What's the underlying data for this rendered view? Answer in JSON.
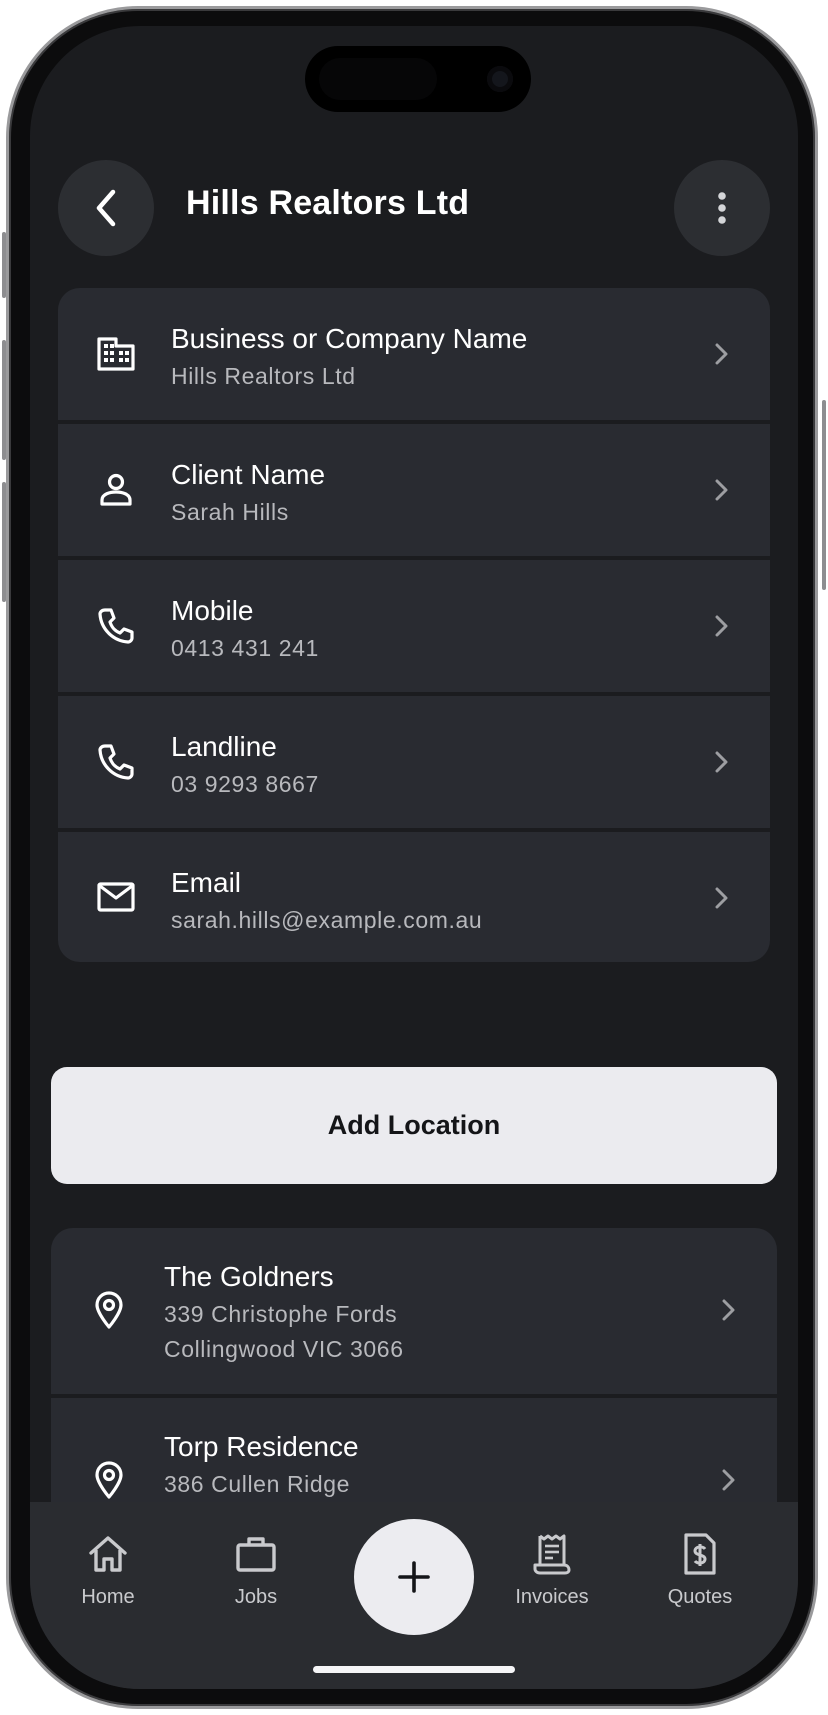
{
  "header": {
    "title": "Hills Realtors Ltd"
  },
  "contact_rows": [
    {
      "icon": "building-icon",
      "label": "Business or Company Name",
      "value": "Hills Realtors Ltd"
    },
    {
      "icon": "person-icon",
      "label": "Client Name",
      "value": "Sarah Hills"
    },
    {
      "icon": "phone-icon",
      "label": "Mobile",
      "value": "0413 431 241"
    },
    {
      "icon": "phone-icon",
      "label": "Landline",
      "value": "03 9293 8667"
    },
    {
      "icon": "mail-icon",
      "label": "Email",
      "value": "sarah.hills@example.com.au"
    }
  ],
  "add_location": {
    "label": "Add Location"
  },
  "locations": [
    {
      "icon": "location-pin-icon",
      "name": "The Goldners",
      "line1": "339 Christophe Fords",
      "line2": "Collingwood VIC 3066"
    },
    {
      "icon": "location-pin-icon",
      "name": "Torp Residence",
      "line1": "386 Cullen Ridge",
      "line2": ""
    }
  ],
  "nav": {
    "items": [
      {
        "icon": "home-icon",
        "label": "Home"
      },
      {
        "icon": "briefcase-icon",
        "label": "Jobs"
      },
      {
        "icon": "receipt-icon",
        "label": "Invoices"
      },
      {
        "icon": "quote-document-icon",
        "label": "Quotes"
      }
    ],
    "fab_icon": "plus-icon"
  },
  "colors": {
    "background": "#1b1c1f",
    "card": "#292b31",
    "accent_button": "#ebebef",
    "text_primary": "#ffffff",
    "text_secondary": "#b8b9bd"
  }
}
